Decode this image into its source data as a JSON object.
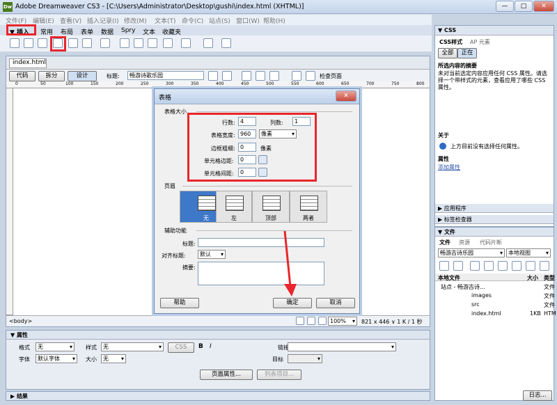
{
  "window": {
    "title": "Adobe Dreamweaver CS3 - [C:\\Users\\Administrator\\Desktop\\gushi\\index.html (XHTML)]",
    "icon": "Dw",
    "min": "—",
    "max": "□",
    "close": "✕"
  },
  "menu": [
    "文件(F)",
    "编辑(E)",
    "查看(V)",
    "插入记录(I)",
    "修改(M)",
    "文本(T)",
    "命令(C)",
    "站点(S)",
    "窗口(W)",
    "帮助(H)"
  ],
  "insert_bar": {
    "label": "▼ 插入",
    "tabs": [
      "常用",
      "布局",
      "表单",
      "数据",
      "Spry",
      "文本",
      "收藏夹"
    ]
  },
  "doc": {
    "tab": "index.html",
    "code": "代码",
    "split": "拆分",
    "design": "设计",
    "title_label": "标题:",
    "title_value": "畅游诗歌乐园",
    "check": "检查页面",
    "ruler": [
      "0",
      "50",
      "100",
      "150",
      "200",
      "250",
      "300",
      "350",
      "400",
      "450",
      "500",
      "550",
      "600",
      "650",
      "700",
      "750",
      "800"
    ],
    "tag": "<body>",
    "zoom": "100%",
    "size": "821 x 446 ∨ 1 K / 1 秒"
  },
  "dialog": {
    "title": "表格",
    "close": "✕",
    "section_size": "表格大小",
    "rows_label": "行数:",
    "rows": "4",
    "cols_label": "列数:",
    "cols": "1",
    "width_label": "表格宽度:",
    "width": "960",
    "width_unit": "像素",
    "border_label": "边框粗细:",
    "border": "0",
    "border_unit": "像素",
    "padding_label": "单元格边距:",
    "padding": "0",
    "spacing_label": "单元格间距:",
    "spacing": "0",
    "section_header": "页眉",
    "headers": [
      "无",
      "左",
      "顶部",
      "两者"
    ],
    "section_access": "辅助功能",
    "caption_label": "标题:",
    "align_label": "对齐标题:",
    "align": "默认",
    "summary_label": "摘要:",
    "help": "帮助",
    "ok": "确定",
    "cancel": "取消"
  },
  "props": {
    "title": "▼ 属性",
    "format_label": "格式",
    "format": "无",
    "style_label": "样式",
    "style": "无",
    "css": "CSS",
    "bold": "B",
    "italic": "I",
    "link_label": "链接",
    "font_label": "字体",
    "font": "默认字体",
    "size_label": "大小",
    "size": "无",
    "target_label": "目标",
    "page_props": "页面属性...",
    "list_item": "列表项目..."
  },
  "results": "▶ 结果",
  "css_panel": {
    "title": "▼ CSS",
    "tabs": [
      "CSS样式",
      "AP 元素"
    ],
    "buttons": [
      "全部",
      "正在"
    ],
    "summary_title": "所选内容的摘要",
    "summary_text": "未对当前选定内容应用任何 CSS 属性。请选择一个带样式的元素，查看应用了哪些 CSS 属性。",
    "about": "关于",
    "about_text": "上方目前没有选择任何属性。",
    "props_title": "属性",
    "add_prop": "添加属性",
    "app": "▶ 应用程序",
    "tag_inspector": "▶ 标签检查器"
  },
  "files_panel": {
    "title": "▼ 文件",
    "tabs": [
      "文件",
      "资源",
      "代码片断"
    ],
    "site": "畅游古诗乐园",
    "view": "本地视图",
    "cols": [
      "本地文件",
      "大小",
      "类型"
    ],
    "items": [
      {
        "name": "站点 - 畅游古诗...",
        "type": "文件"
      },
      {
        "name": "images",
        "type": "文件"
      },
      {
        "name": "src",
        "type": "文件"
      },
      {
        "name": "index.html",
        "size": "1KB",
        "type": "HTM"
      }
    ],
    "log": "日志..."
  },
  "colors": {
    "accent": "#e8262b",
    "selected_header": "#3e78c8"
  }
}
